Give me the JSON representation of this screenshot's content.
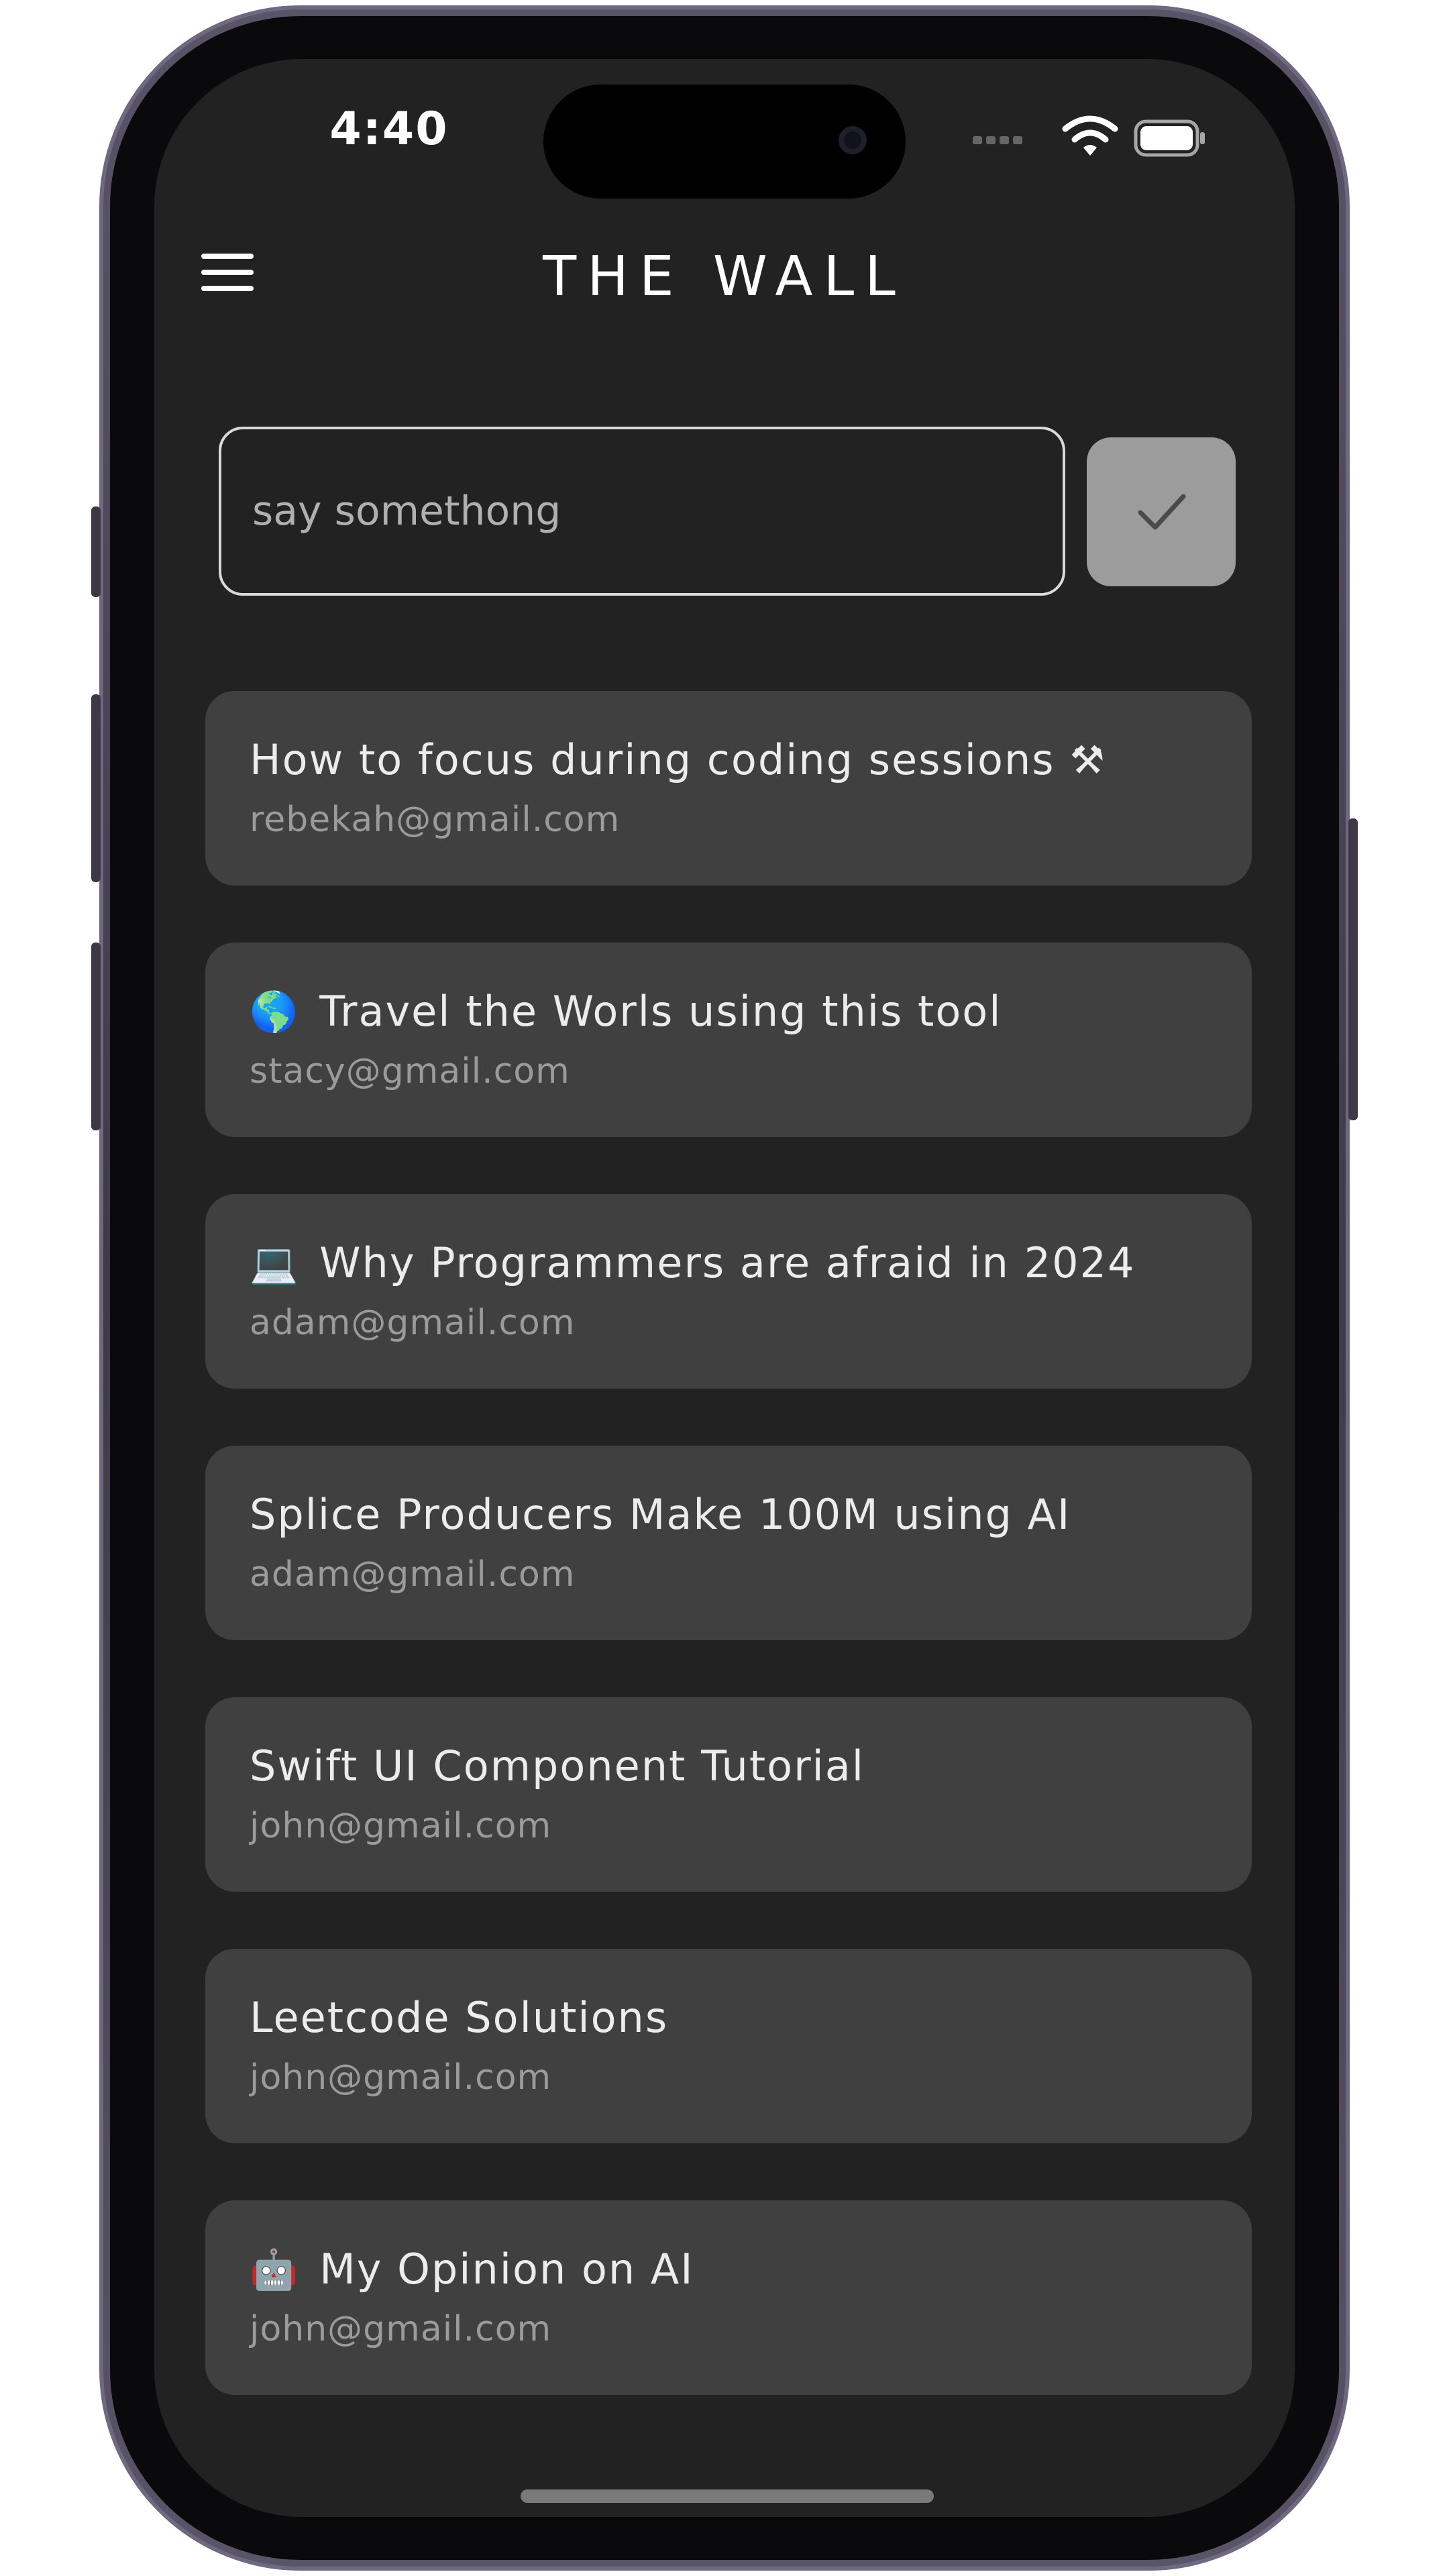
{
  "status_bar": {
    "time": "4:40",
    "icons": [
      "signal-dots-icon",
      "wifi-icon",
      "battery-icon"
    ]
  },
  "header": {
    "title": "THE WALL",
    "menu_icon": "hamburger-menu-icon"
  },
  "composer": {
    "input_value": "say somethong",
    "submit_icon": "checkmark-icon"
  },
  "posts": [
    {
      "title": "How to focus during coding sessions",
      "emoji_after": "⚒",
      "email": "rebekah@gmail.com"
    },
    {
      "emoji": "🌎",
      "title": "Travel the Worls using this tool",
      "email": "stacy@gmail.com"
    },
    {
      "emoji": "💻",
      "title": "Why Programmers are afraid in 2024",
      "email": "adam@gmail.com"
    },
    {
      "title": "Splice Producers Make 100M using AI",
      "email": "adam@gmail.com"
    },
    {
      "title": "Swift UI Component Tutorial",
      "email": "john@gmail.com"
    },
    {
      "title": "Leetcode Solutions",
      "email": "john@gmail.com"
    },
    {
      "emoji": "🤖",
      "title": "My Opinion on AI",
      "email": "john@gmail.com"
    }
  ],
  "colors": {
    "background": "#222222",
    "card": "#404040",
    "submit_button": "#9c9c9c",
    "input_border": "#d9d9d9"
  }
}
